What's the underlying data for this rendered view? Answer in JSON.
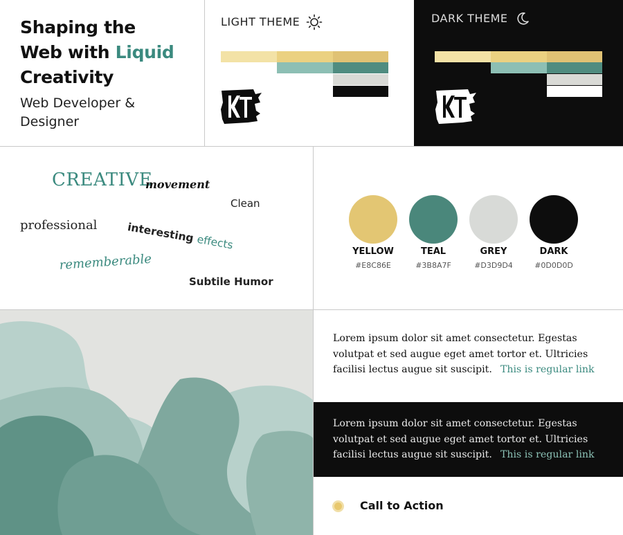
{
  "header": {
    "title_line1": "Shaping the",
    "title_line2_prefix": "Web with ",
    "title_line2_accent": "Liquid",
    "title_line3": "Creativity",
    "subtitle_line1": "Web Developer &",
    "subtitle_line2": "Designer"
  },
  "themes": {
    "light_label": "LIGHT THEME",
    "dark_label": "DARK THEME",
    "light_icon": "sun-icon",
    "dark_icon": "moon-icon",
    "logo_text": "KT"
  },
  "keywords": {
    "creative": "CREATIVE",
    "movement": "movement",
    "clean": "Clean",
    "professional": "professional",
    "interesting": "interesting",
    "effects": "effects",
    "rememberable": "rememberable",
    "subtile_humor": "Subtile Humor"
  },
  "palette": [
    {
      "name": "YELLOW",
      "hex": "#E8C86E"
    },
    {
      "name": "TEAL",
      "hex": "#3B8A7F"
    },
    {
      "name": "GREY",
      "hex": "#D3D9D4"
    },
    {
      "name": "DARK",
      "hex": "#0D0D0D"
    }
  ],
  "samples": {
    "paragraph": "Lorem ipsum dolor sit amet consectetur. Egestas volutpat et sed augue eget amet tortor et. Ultricies facilisi lectus augue sit suscipit.",
    "link": "This is regular link"
  },
  "cta": {
    "label": "Call to Action"
  },
  "colors": {
    "yellow": "#E8C86E",
    "teal": "#3B8A7F",
    "grey": "#D3D9D4",
    "dark": "#0D0D0D"
  }
}
